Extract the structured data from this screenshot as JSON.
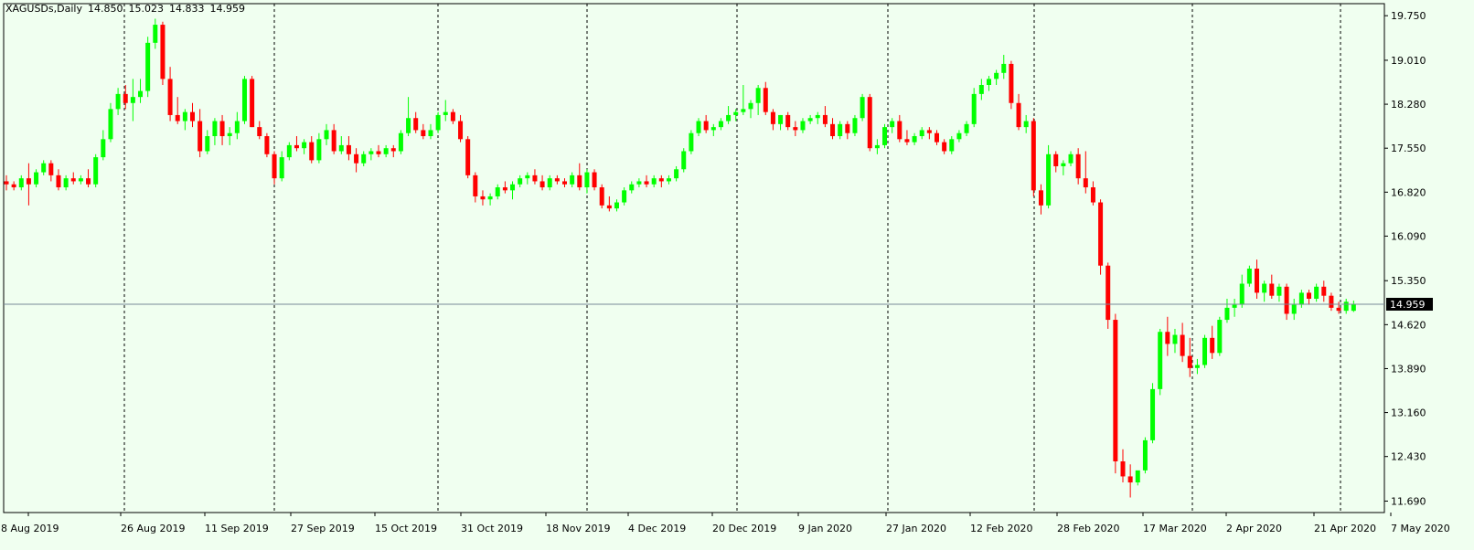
{
  "header": {
    "symbol": "XAGUSDs,Daily",
    "open": "14.850",
    "high": "15.023",
    "low": "14.833",
    "close": "14.959"
  },
  "price_marker": "14.959",
  "colors": {
    "background": "#f0fff0",
    "bull": "#00ff00",
    "bear": "#ff0000",
    "axis": "#000000",
    "grid": "#000000",
    "price_line": "#778899",
    "marker_bg": "#000000",
    "marker_text": "#ffffff"
  },
  "chart_data": {
    "type": "candlestick",
    "title": "XAGUSDs,Daily",
    "ylim": [
      11.5,
      19.95
    ],
    "y_ticks": [
      "11.690",
      "12.430",
      "13.160",
      "13.890",
      "14.620",
      "15.350",
      "16.090",
      "16.820",
      "17.550",
      "18.280",
      "19.010",
      "19.750"
    ],
    "x_labels": [
      "8 Aug 2019",
      "26 Aug 2019",
      "11 Sep 2019",
      "27 Sep 2019",
      "15 Oct 2019",
      "31 Oct 2019",
      "18 Nov 2019",
      "4 Dec 2019",
      "20 Dec 2019",
      "9 Jan 2020",
      "27 Jan 2020",
      "12 Feb 2020",
      "28 Feb 2020",
      "17 Mar 2020",
      "2 Apr 2020",
      "21 Apr 2020",
      "7 May 2020"
    ],
    "period_separators": [
      "26 Aug 2019",
      "27 Sep 2019",
      "31 Oct 2019",
      "4 Dec 2019",
      "20 Dec 2019",
      "27 Jan 2020",
      "28 Feb 2020",
      "2 Apr 2020",
      "21 Apr 2020"
    ],
    "grid": false,
    "series": [
      {
        "ohlc": [
          [
            17.0,
            17.1,
            16.85,
            16.95
          ],
          [
            16.95,
            17.0,
            16.85,
            16.9
          ],
          [
            16.9,
            17.1,
            16.85,
            17.05
          ],
          [
            17.05,
            17.3,
            16.6,
            16.95
          ],
          [
            16.95,
            17.2,
            16.9,
            17.15
          ],
          [
            17.15,
            17.35,
            17.1,
            17.3
          ],
          [
            17.3,
            17.35,
            17.0,
            17.1
          ],
          [
            17.1,
            17.2,
            16.85,
            16.9
          ],
          [
            16.9,
            17.1,
            16.85,
            17.05
          ],
          [
            17.05,
            17.15,
            16.95,
            17.0
          ],
          [
            17.0,
            17.1,
            16.95,
            17.05
          ],
          [
            17.05,
            17.2,
            16.9,
            16.95
          ],
          [
            16.95,
            17.45,
            16.9,
            17.4
          ],
          [
            17.4,
            17.85,
            17.35,
            17.7
          ],
          [
            17.7,
            18.3,
            17.65,
            18.2
          ],
          [
            18.2,
            18.55,
            18.1,
            18.45
          ],
          [
            18.45,
            18.6,
            18.2,
            18.3
          ],
          [
            18.3,
            18.7,
            18.0,
            18.4
          ],
          [
            18.4,
            18.7,
            18.3,
            18.5
          ],
          [
            18.5,
            19.4,
            18.4,
            19.3
          ],
          [
            19.3,
            19.7,
            19.2,
            19.6
          ],
          [
            19.6,
            19.65,
            18.6,
            18.7
          ],
          [
            18.7,
            18.9,
            18.0,
            18.1
          ],
          [
            18.1,
            18.4,
            17.95,
            18.0
          ],
          [
            18.0,
            18.2,
            17.85,
            18.15
          ],
          [
            18.15,
            18.3,
            17.9,
            18.0
          ],
          [
            18.0,
            18.2,
            17.4,
            17.5
          ],
          [
            17.5,
            17.85,
            17.45,
            17.75
          ],
          [
            17.75,
            18.05,
            17.6,
            18.0
          ],
          [
            18.0,
            18.1,
            17.6,
            17.75
          ],
          [
            17.75,
            17.9,
            17.6,
            17.8
          ],
          [
            17.8,
            18.15,
            17.7,
            18.0
          ],
          [
            18.0,
            18.75,
            17.95,
            18.7
          ],
          [
            18.7,
            18.75,
            17.9,
            17.9
          ],
          [
            17.9,
            18.0,
            17.7,
            17.75
          ],
          [
            17.75,
            17.8,
            17.4,
            17.45
          ],
          [
            17.45,
            17.5,
            16.95,
            17.05
          ],
          [
            17.05,
            17.5,
            17.0,
            17.4
          ],
          [
            17.4,
            17.65,
            17.35,
            17.6
          ],
          [
            17.6,
            17.75,
            17.5,
            17.55
          ],
          [
            17.55,
            17.7,
            17.45,
            17.65
          ],
          [
            17.65,
            17.75,
            17.3,
            17.35
          ],
          [
            17.35,
            17.8,
            17.3,
            17.7
          ],
          [
            17.7,
            17.95,
            17.6,
            17.85
          ],
          [
            17.85,
            17.95,
            17.45,
            17.5
          ],
          [
            17.5,
            17.75,
            17.45,
            17.6
          ],
          [
            17.6,
            17.75,
            17.35,
            17.45
          ],
          [
            17.45,
            17.55,
            17.15,
            17.3
          ],
          [
            17.3,
            17.5,
            17.25,
            17.45
          ],
          [
            17.45,
            17.55,
            17.35,
            17.5
          ],
          [
            17.5,
            17.6,
            17.4,
            17.45
          ],
          [
            17.45,
            17.6,
            17.4,
            17.55
          ],
          [
            17.55,
            17.6,
            17.4,
            17.5
          ],
          [
            17.5,
            17.85,
            17.45,
            17.8
          ],
          [
            17.8,
            18.4,
            17.75,
            18.05
          ],
          [
            18.05,
            18.15,
            17.8,
            17.85
          ],
          [
            17.85,
            17.95,
            17.7,
            17.75
          ],
          [
            17.75,
            17.95,
            17.7,
            17.85
          ],
          [
            17.85,
            18.15,
            17.8,
            18.1
          ],
          [
            18.1,
            18.35,
            18.0,
            18.15
          ],
          [
            18.15,
            18.2,
            17.95,
            18.0
          ],
          [
            18.0,
            18.1,
            17.65,
            17.7
          ],
          [
            17.7,
            17.75,
            17.05,
            17.1
          ],
          [
            17.1,
            17.15,
            16.65,
            16.75
          ],
          [
            16.75,
            16.85,
            16.6,
            16.7
          ],
          [
            16.7,
            16.8,
            16.6,
            16.75
          ],
          [
            16.75,
            16.95,
            16.7,
            16.9
          ],
          [
            16.9,
            17.0,
            16.8,
            16.85
          ],
          [
            16.85,
            17.0,
            16.7,
            16.95
          ],
          [
            16.95,
            17.1,
            16.9,
            17.05
          ],
          [
            17.05,
            17.15,
            16.95,
            17.1
          ],
          [
            17.1,
            17.2,
            16.95,
            17.0
          ],
          [
            17.0,
            17.1,
            16.85,
            16.9
          ],
          [
            16.9,
            17.1,
            16.85,
            17.05
          ],
          [
            17.05,
            17.1,
            16.95,
            17.0
          ],
          [
            17.0,
            17.05,
            16.9,
            16.95
          ],
          [
            16.95,
            17.15,
            16.9,
            17.1
          ],
          [
            17.1,
            17.3,
            16.85,
            16.9
          ],
          [
            16.9,
            17.2,
            16.8,
            17.15
          ],
          [
            17.15,
            17.2,
            16.85,
            16.9
          ],
          [
            16.9,
            16.95,
            16.55,
            16.6
          ],
          [
            16.6,
            16.75,
            16.5,
            16.55
          ],
          [
            16.55,
            16.7,
            16.5,
            16.65
          ],
          [
            16.65,
            16.9,
            16.6,
            16.85
          ],
          [
            16.85,
            17.0,
            16.8,
            16.95
          ],
          [
            16.95,
            17.05,
            16.9,
            17.0
          ],
          [
            17.0,
            17.1,
            16.9,
            16.95
          ],
          [
            16.95,
            17.1,
            16.9,
            17.05
          ],
          [
            17.05,
            17.1,
            16.9,
            17.0
          ],
          [
            17.0,
            17.1,
            16.95,
            17.05
          ],
          [
            17.05,
            17.25,
            17.0,
            17.2
          ],
          [
            17.2,
            17.55,
            17.15,
            17.5
          ],
          [
            17.5,
            17.85,
            17.45,
            17.8
          ],
          [
            17.8,
            18.05,
            17.75,
            18.0
          ],
          [
            18.0,
            18.1,
            17.8,
            17.85
          ],
          [
            17.85,
            17.95,
            17.75,
            17.9
          ],
          [
            17.9,
            18.05,
            17.85,
            18.0
          ],
          [
            18.0,
            18.25,
            17.95,
            18.1
          ],
          [
            18.1,
            18.2,
            18.0,
            18.15
          ],
          [
            18.15,
            18.6,
            18.1,
            18.2
          ],
          [
            18.2,
            18.35,
            18.05,
            18.3
          ],
          [
            18.3,
            18.6,
            18.1,
            18.55
          ],
          [
            18.55,
            18.65,
            18.1,
            18.15
          ],
          [
            18.15,
            18.2,
            17.85,
            17.95
          ],
          [
            17.95,
            18.1,
            17.85,
            18.1
          ],
          [
            18.1,
            18.15,
            17.85,
            17.9
          ],
          [
            17.9,
            18.0,
            17.75,
            17.85
          ],
          [
            17.85,
            18.05,
            17.8,
            18.0
          ],
          [
            18.0,
            18.1,
            17.95,
            18.05
          ],
          [
            18.05,
            18.15,
            17.95,
            18.1
          ],
          [
            18.1,
            18.25,
            17.9,
            17.95
          ],
          [
            17.95,
            18.05,
            17.7,
            17.75
          ],
          [
            17.75,
            18.0,
            17.7,
            17.95
          ],
          [
            17.95,
            18.0,
            17.7,
            17.8
          ],
          [
            17.8,
            18.1,
            17.75,
            18.05
          ],
          [
            18.05,
            18.45,
            18.0,
            18.4
          ],
          [
            18.4,
            18.45,
            17.5,
            17.55
          ],
          [
            17.55,
            17.7,
            17.45,
            17.6
          ],
          [
            17.6,
            17.95,
            17.55,
            17.9
          ],
          [
            17.9,
            18.05,
            17.8,
            18.0
          ],
          [
            18.0,
            18.1,
            17.65,
            17.7
          ],
          [
            17.7,
            17.85,
            17.6,
            17.65
          ],
          [
            17.65,
            17.8,
            17.6,
            17.75
          ],
          [
            17.75,
            17.9,
            17.7,
            17.85
          ],
          [
            17.85,
            17.9,
            17.7,
            17.8
          ],
          [
            17.8,
            17.85,
            17.6,
            17.65
          ],
          [
            17.65,
            17.7,
            17.45,
            17.5
          ],
          [
            17.5,
            17.75,
            17.45,
            17.7
          ],
          [
            17.7,
            17.85,
            17.65,
            17.8
          ],
          [
            17.8,
            18.0,
            17.75,
            17.95
          ],
          [
            17.95,
            18.55,
            17.9,
            18.45
          ],
          [
            18.45,
            18.7,
            18.35,
            18.6
          ],
          [
            18.6,
            18.75,
            18.5,
            18.7
          ],
          [
            18.7,
            18.85,
            18.6,
            18.8
          ],
          [
            18.8,
            19.1,
            18.7,
            18.95
          ],
          [
            18.95,
            19.0,
            18.2,
            18.3
          ],
          [
            18.3,
            18.45,
            17.85,
            17.9
          ],
          [
            17.9,
            18.1,
            17.8,
            18.0
          ],
          [
            18.0,
            18.05,
            16.75,
            16.85
          ],
          [
            16.85,
            16.95,
            16.45,
            16.6
          ],
          [
            16.6,
            17.6,
            16.55,
            17.45
          ],
          [
            17.45,
            17.5,
            17.15,
            17.25
          ],
          [
            17.25,
            17.35,
            17.1,
            17.3
          ],
          [
            17.3,
            17.5,
            17.25,
            17.45
          ],
          [
            17.45,
            17.55,
            16.95,
            17.05
          ],
          [
            17.05,
            17.5,
            16.8,
            16.9
          ],
          [
            16.9,
            17.0,
            16.6,
            16.65
          ],
          [
            16.65,
            16.7,
            15.45,
            15.6
          ],
          [
            15.6,
            15.65,
            14.55,
            14.7
          ],
          [
            14.7,
            14.8,
            12.15,
            12.35
          ],
          [
            12.35,
            12.55,
            12.0,
            12.1
          ],
          [
            12.1,
            12.3,
            11.75,
            12.0
          ],
          [
            12.0,
            12.1,
            11.95,
            12.2
          ],
          [
            12.2,
            12.75,
            12.15,
            12.7
          ],
          [
            12.7,
            13.65,
            12.65,
            13.55
          ],
          [
            13.55,
            14.55,
            13.45,
            14.5
          ],
          [
            14.5,
            14.75,
            14.1,
            14.3
          ],
          [
            14.3,
            14.55,
            14.15,
            14.45
          ],
          [
            14.45,
            14.65,
            14.0,
            14.1
          ],
          [
            14.1,
            14.4,
            13.75,
            13.9
          ],
          [
            13.9,
            14.05,
            13.8,
            13.95
          ],
          [
            13.95,
            14.45,
            13.9,
            14.4
          ],
          [
            14.4,
            14.6,
            14.05,
            14.15
          ],
          [
            14.15,
            14.75,
            14.1,
            14.7
          ],
          [
            14.7,
            15.05,
            14.65,
            14.9
          ],
          [
            14.9,
            15.05,
            14.75,
            14.95
          ],
          [
            14.95,
            15.45,
            14.9,
            15.3
          ],
          [
            15.3,
            15.6,
            15.25,
            15.55
          ],
          [
            15.55,
            15.7,
            15.05,
            15.15
          ],
          [
            15.15,
            15.35,
            15.0,
            15.3
          ],
          [
            15.3,
            15.45,
            15.05,
            15.1
          ],
          [
            15.1,
            15.3,
            15.0,
            15.25
          ],
          [
            15.25,
            15.3,
            14.7,
            14.8
          ],
          [
            14.8,
            15.05,
            14.7,
            14.95
          ],
          [
            14.95,
            15.2,
            14.9,
            15.15
          ],
          [
            15.15,
            15.2,
            14.95,
            15.05
          ],
          [
            15.05,
            15.3,
            15.0,
            15.25
          ],
          [
            15.25,
            15.35,
            15.0,
            15.1
          ],
          [
            15.1,
            15.15,
            14.85,
            14.9
          ],
          [
            14.9,
            15.0,
            14.8,
            14.85
          ],
          [
            14.85,
            15.05,
            14.8,
            15.0
          ],
          [
            14.85,
            15.02,
            14.83,
            14.96
          ]
        ]
      }
    ]
  }
}
